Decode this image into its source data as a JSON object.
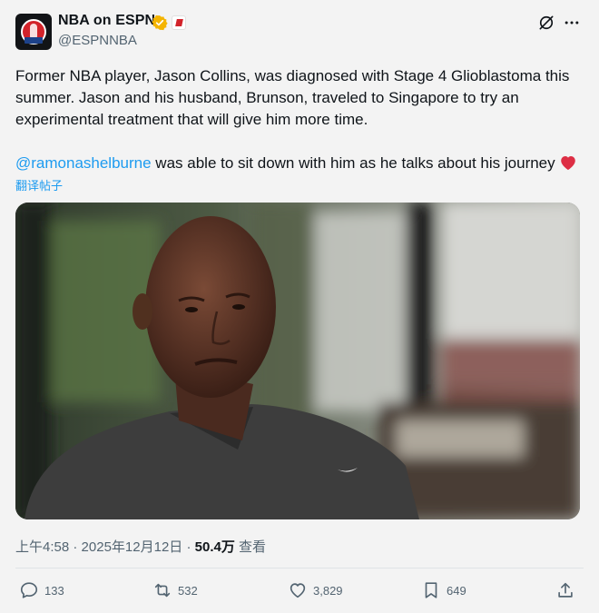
{
  "author": {
    "display_name": "NBA on ESPN",
    "handle": "@ESPNNBA",
    "verified": true,
    "avatar_icon": "nba-logo-avatar",
    "affiliate_icon": "espn-e-badge-icon",
    "verified_color": "#f4b400"
  },
  "header_actions": {
    "grok_icon": "grok-icon",
    "more_icon": "more-horizontal-icon"
  },
  "tweet": {
    "text": "Former NBA player, Jason Collins, was diagnosed with Stage 4 Glioblastoma this summer. Jason and his husband, Brunson, traveled to Singapore to try an experimental treatment that will give him more time.",
    "mention": "@ramonashelburne",
    "text_after_mention": " was able to sit down with him as he talks about his journey",
    "emoji": "red-heart",
    "translate_label": "翻译帖子"
  },
  "media": {
    "type": "video-thumbnail"
  },
  "meta": {
    "time": "上午4:58",
    "separator": " · ",
    "date": "2025年12月12日",
    "views_count": "50.4万",
    "views_label": "查看"
  },
  "actions": {
    "replies": "133",
    "retweets": "532",
    "likes": "3,829",
    "bookmarks": "649"
  },
  "colors": {
    "accent": "#1d9bf0",
    "muted": "#536471",
    "background": "#f3f3f3",
    "heart": "#e0245e"
  }
}
